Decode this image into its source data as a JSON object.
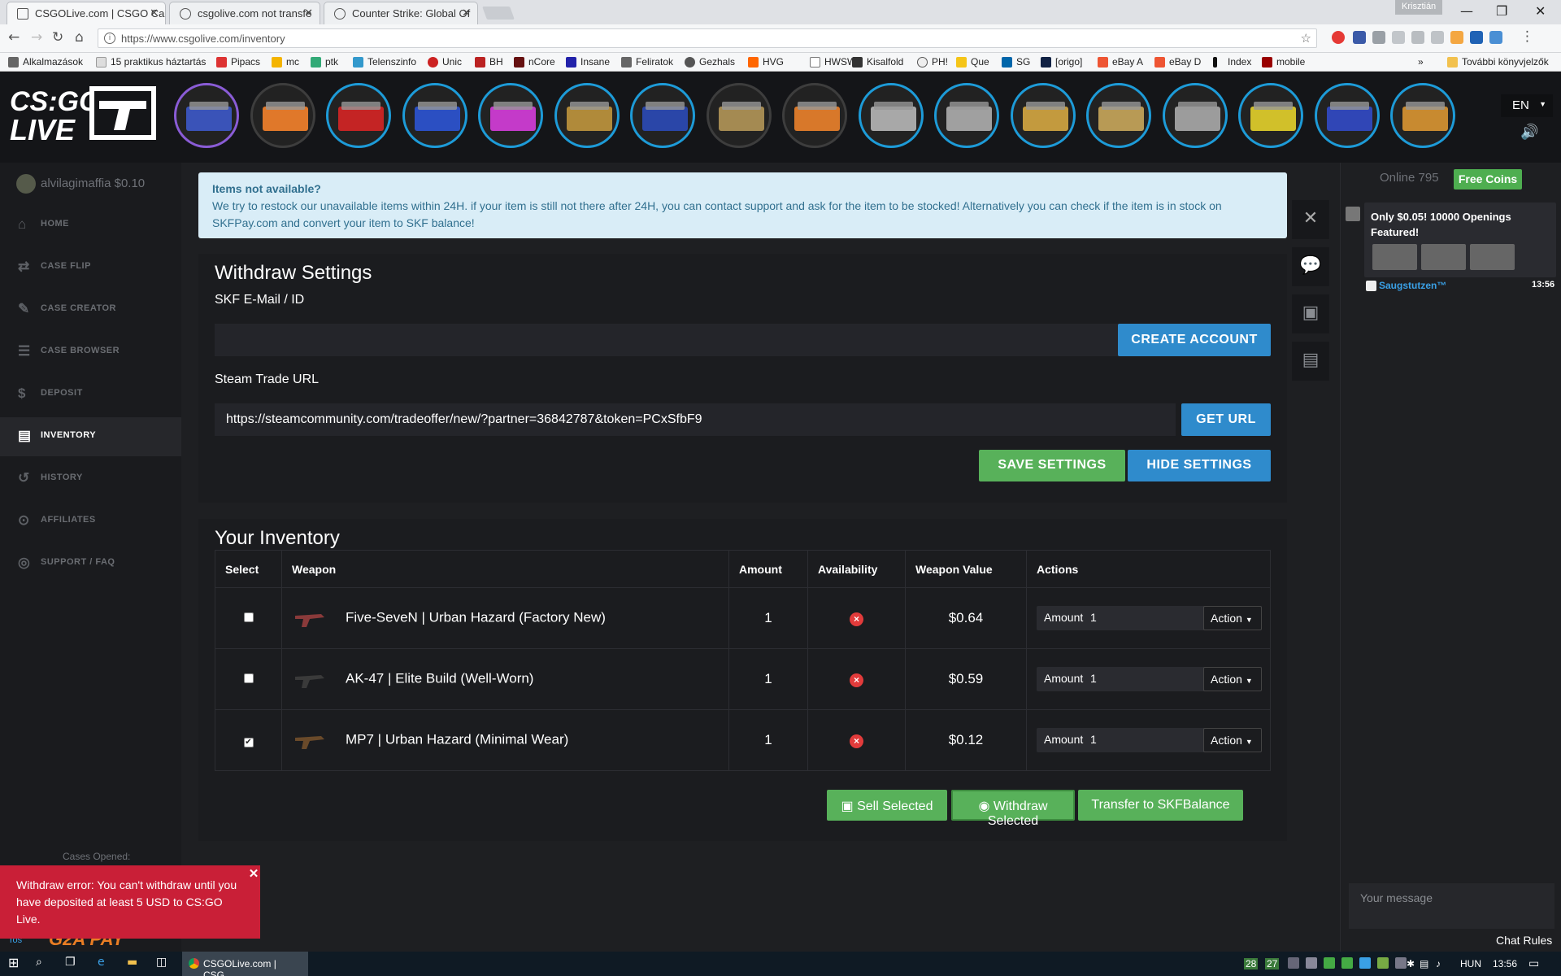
{
  "browser": {
    "tabs": [
      {
        "title": "CSGOLive.com | CSGO Ca",
        "active": true
      },
      {
        "title": "csgolive.com not transfe",
        "active": false
      },
      {
        "title": "Counter Strike: Global Of",
        "active": false
      }
    ],
    "window_user": "Krisztián",
    "url": "https://www.csgolive.com/inventory",
    "bookmarks": [
      "Alkalmazások",
      "15 praktikus háztartás",
      "Pipacs",
      "mc",
      "ptk",
      "Telenszinfo",
      "Unic",
      "BH",
      "nCore",
      "Insane",
      "Feliratok",
      "Gezhals",
      "HVG",
      "HWSW",
      "Kisalfold",
      "PH!",
      "Que",
      "SG",
      "[origo]",
      "eBay A",
      "eBay D",
      "Index",
      "mobile"
    ],
    "other_bookmarks": "További könyvjelzők"
  },
  "header": {
    "logo_text_top": "CS:GO",
    "logo_text_bottom": "LIVE",
    "language": "EN"
  },
  "sidebar": {
    "user": "alvilagimaffia $0.10",
    "items": [
      {
        "label": "HOME",
        "icon": "home-icon",
        "glyph": "⌂"
      },
      {
        "label": "CASE FLIP",
        "icon": "exchange-icon",
        "glyph": "⇄"
      },
      {
        "label": "CASE CREATOR",
        "icon": "edit-icon",
        "glyph": "✎"
      },
      {
        "label": "CASE BROWSER",
        "icon": "list-icon",
        "glyph": "☰"
      },
      {
        "label": "DEPOSIT",
        "icon": "dollar-icon",
        "glyph": "$"
      },
      {
        "label": "INVENTORY",
        "icon": "inventory-icon",
        "glyph": "▤"
      },
      {
        "label": "HISTORY",
        "icon": "history-icon",
        "glyph": "↺"
      },
      {
        "label": "AFFILIATES",
        "icon": "affiliates-icon",
        "glyph": "⊙"
      },
      {
        "label": "SUPPORT / FAQ",
        "icon": "lifebuoy-icon",
        "glyph": "◎"
      }
    ],
    "cases_opened_label": "Cases Opened:",
    "partner_logo": "G2A PAY",
    "partner_logo_prefix": "Tos"
  },
  "alert": {
    "title": "Items not available?",
    "body": "We try to restock our unavailable items within 24H. if your item is still not there after 24H, you can contact support and ask for the item to be stocked! Alternatively you can check if the item is in stock on SKFPay.com and convert your item to SKF balance!"
  },
  "withdraw_settings": {
    "title": "Withdraw Settings",
    "skf_label": "SKF E-Mail / ID",
    "skf_value": "",
    "create_account": "CREATE ACCOUNT",
    "steam_label": "Steam Trade URL",
    "steam_value": "https://steamcommunity.com/tradeoffer/new/?partner=36842787&token=PCxSfbF9",
    "get_url": "GET URL",
    "save_settings": "SAVE SETTINGS",
    "hide_settings": "HIDE SETTINGS"
  },
  "inventory": {
    "title": "Your Inventory",
    "columns": [
      "Select",
      "Weapon",
      "Amount",
      "Availability",
      "Weapon Value",
      "Actions"
    ],
    "rows": [
      {
        "checked": false,
        "weapon": "Five-SeveN | Urban Hazard (Factory New)",
        "amount": "1",
        "available": false,
        "value": "$0.64",
        "action_amount_label": "Amount",
        "action_amount": "1",
        "action_label": "Action"
      },
      {
        "checked": false,
        "weapon": "AK-47 | Elite Build (Well-Worn)",
        "amount": "1",
        "available": false,
        "value": "$0.59",
        "action_amount_label": "Amount",
        "action_amount": "1",
        "action_label": "Action"
      },
      {
        "checked": true,
        "weapon": "MP7 | Urban Hazard (Minimal Wear)",
        "amount": "1",
        "available": false,
        "value": "$0.12",
        "action_amount_label": "Amount",
        "action_amount": "1",
        "action_label": "Action"
      }
    ],
    "sell_selected": "Sell Selected",
    "withdraw_selected": "Withdraw Selected",
    "transfer": "Transfer to SKFBalance"
  },
  "chat": {
    "online": "Online 795",
    "free_coins": "Free Coins",
    "message_text": "Only $0.05! 10000 Openings Featured!",
    "message_user": "Saugstutzen™",
    "message_time": "13:56",
    "input_placeholder": "Your message",
    "rules": "Chat Rules"
  },
  "toast": {
    "text": "Withdraw error: You can't withdraw until you have deposited at least 5 USD to CS:GO Live."
  },
  "taskbar": {
    "app": "CSGOLive.com | CSG...",
    "tray_num1": "28",
    "tray_num2": "27",
    "lang": "HUN",
    "time": "13:56"
  },
  "colors": {
    "accent_blue": "#2f8bcc",
    "accent_green": "#58b15a",
    "error_red": "#c91f37",
    "info_bg": "#d9edf7"
  }
}
